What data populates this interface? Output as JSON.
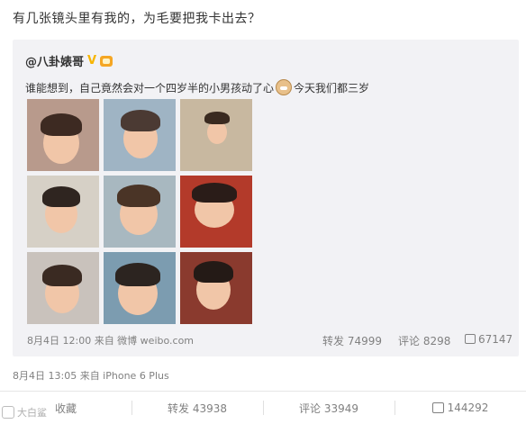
{
  "post": {
    "text": "有几张镜头里有我的，为毛要把我卡出去？",
    "meta": "8月4日 13:05 来自 iPhone 6 Plus"
  },
  "quoted": {
    "author": "@八卦婊哥",
    "verified_badge": "V",
    "text_before": "谁能想到，自己竟然会对一个四岁半的小男孩动了心",
    "text_after": "今天我们都三岁",
    "emoji": "doge-icon",
    "meta": "8月4日 12:00 来自 微博 weibo.com",
    "repost": "转发 74999",
    "comment": "评论 8298",
    "like": "67147",
    "images": [
      {
        "name": "photo-1",
        "bg": "#b89a8c",
        "hair": "#3d2a22"
      },
      {
        "name": "photo-2",
        "bg": "#9fb4c4",
        "hair": "#4b3a33"
      },
      {
        "name": "photo-3",
        "bg": "#c8b8a0",
        "hair": "#3a2a20"
      },
      {
        "name": "photo-4",
        "bg": "#d6d0c6",
        "hair": "#2f2520"
      },
      {
        "name": "photo-5",
        "bg": "#a8b8c0",
        "hair": "#4a3426"
      },
      {
        "name": "photo-6",
        "bg": "#b33a2a",
        "hair": "#2a1c18"
      },
      {
        "name": "photo-7",
        "bg": "#c9c2bc",
        "hair": "#3a2a22"
      },
      {
        "name": "photo-8",
        "bg": "#7c9cb0",
        "hair": "#2c2420"
      },
      {
        "name": "photo-9",
        "bg": "#8a3a2e",
        "hair": "#241a16"
      }
    ]
  },
  "actions": {
    "favorite": "收藏",
    "repost": "转发 43938",
    "comment": "评论 33949",
    "like": "144292"
  },
  "watermark": "大白鲨"
}
